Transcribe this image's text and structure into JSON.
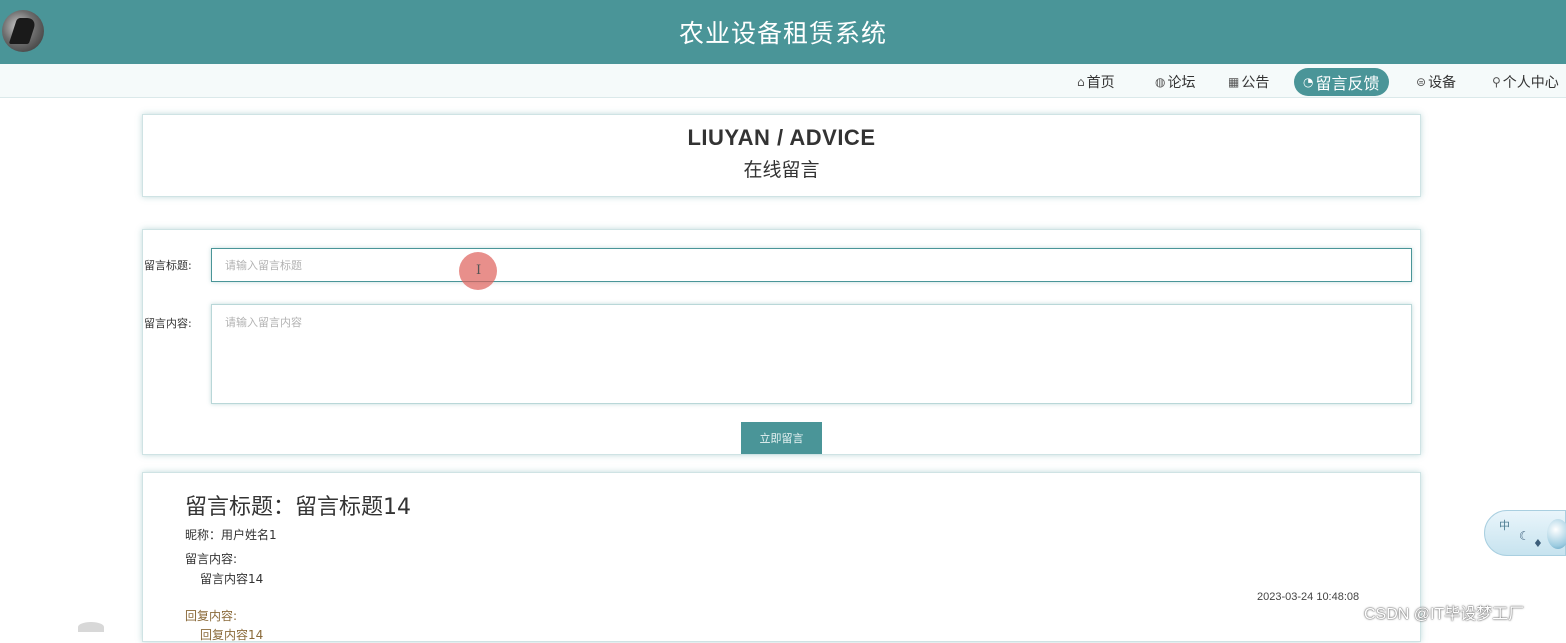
{
  "header": {
    "site_title": "农业设备租赁系统"
  },
  "nav": {
    "items": [
      {
        "icon": "home-icon",
        "glyph": "⌂",
        "label": "首页",
        "active": false
      },
      {
        "icon": "forum-icon",
        "glyph": "◍",
        "label": "论坛",
        "active": false
      },
      {
        "icon": "notice-icon",
        "glyph": "▦",
        "label": "公告",
        "active": false
      },
      {
        "icon": "feedback-icon",
        "glyph": "◔",
        "label": "留言反馈",
        "active": true
      },
      {
        "icon": "device-icon",
        "glyph": "⊜",
        "label": "设备",
        "active": false
      },
      {
        "icon": "user-icon",
        "glyph": "⚲",
        "label": "个人中心",
        "active": false
      }
    ]
  },
  "page_heading": {
    "en": "LIUYAN / ADVICE",
    "cn": "在线留言"
  },
  "form": {
    "title_label": "留言标题:",
    "title_placeholder": "请输入留言标题",
    "title_value": "",
    "content_label": "留言内容:",
    "content_placeholder": "请输入留言内容",
    "content_value": "",
    "submit_label": "立即留言"
  },
  "message": {
    "title": "留言标题：留言标题14",
    "nickname": "昵称：用户姓名1",
    "content_label": "留言内容:",
    "content": "留言内容14",
    "time": "2023-03-24 10:48:08",
    "reply_label": "回复内容:",
    "reply_content": "回复内容14"
  },
  "widget": {
    "lang": "中"
  },
  "watermark": "CSDN @IT毕设梦工厂",
  "colors": {
    "primary": "#4a9598",
    "cursor_highlight": "#de5f5a"
  }
}
